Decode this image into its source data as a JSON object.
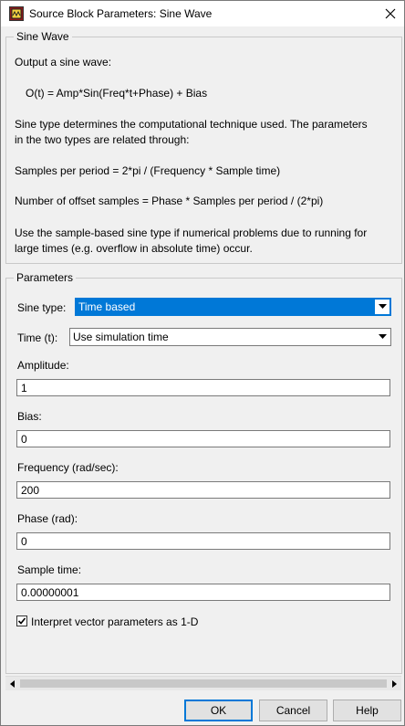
{
  "window": {
    "title": "Source Block Parameters: Sine Wave"
  },
  "description": {
    "legend": "Sine Wave",
    "lines": [
      "Output a sine wave:",
      "O(t) = Amp*Sin(Freq*t+Phase) + Bias",
      "Sine type determines the computational technique used. The parameters",
      "in the two types are related through:",
      "Samples per period = 2*pi / (Frequency * Sample time)",
      "Number of offset samples = Phase * Samples per period / (2*pi)",
      "Use the sample-based sine type if numerical problems due to running for",
      "large times (e.g. overflow in absolute time) occur."
    ]
  },
  "parameters": {
    "legend": "Parameters",
    "sine_type": {
      "label": "Sine type:",
      "value": "Time based"
    },
    "time": {
      "label": "Time (t):",
      "value": "Use simulation time"
    },
    "amplitude": {
      "label": "Amplitude:",
      "value": "1"
    },
    "bias": {
      "label": "Bias:",
      "value": "0"
    },
    "frequency": {
      "label": "Frequency (rad/sec):",
      "value": "200"
    },
    "phase": {
      "label": "Phase (rad):",
      "value": "0"
    },
    "sample_time": {
      "label": "Sample time:",
      "value": "0.00000001"
    },
    "interpret_vector": {
      "label": "Interpret vector parameters as 1-D",
      "checked": true
    }
  },
  "buttons": {
    "ok": "OK",
    "cancel": "Cancel",
    "help": "Help"
  },
  "colors": {
    "selection": "#0078d7",
    "window_bg": "#f0f0f0"
  },
  "icons": {
    "app": "simulink-block-icon",
    "close": "close-icon",
    "dropdown": "chevron-down-icon"
  }
}
